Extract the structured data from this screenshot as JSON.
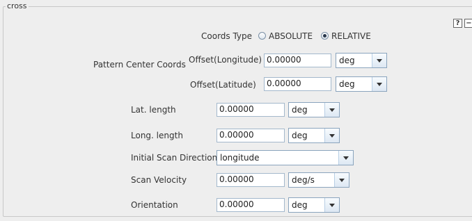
{
  "panel": {
    "title": "cross",
    "help_label": "?",
    "minimize_label": "−"
  },
  "coords_type": {
    "label": "Coords Type",
    "options": [
      "ABSOLUTE",
      "RELATIVE"
    ],
    "selected": "RELATIVE"
  },
  "pattern_center": {
    "label": "Pattern Center Coords",
    "offset_longitude": {
      "label": "Offset(Longitude)",
      "value": "0.00000",
      "unit": "deg"
    },
    "offset_latitude": {
      "label": "Offset(Latitude)",
      "value": "0.00000",
      "unit": "deg"
    }
  },
  "lat_length": {
    "label": "Lat. length",
    "value": "0.00000",
    "unit": "deg"
  },
  "long_length": {
    "label": "Long. length",
    "value": "0.00000",
    "unit": "deg"
  },
  "initial_scan_direction": {
    "label": "Initial Scan Direction",
    "value": "longitude"
  },
  "scan_velocity": {
    "label": "Scan Velocity",
    "value": "0.00000",
    "unit": "deg/s"
  },
  "orientation": {
    "label": "Orientation",
    "value": "0.00000",
    "unit": "deg"
  }
}
